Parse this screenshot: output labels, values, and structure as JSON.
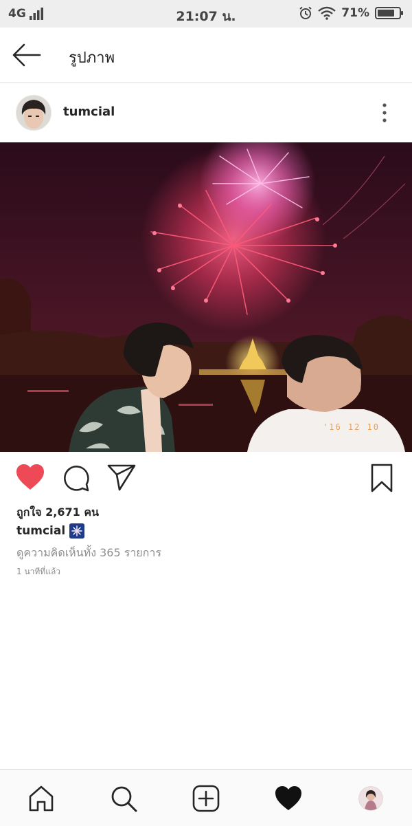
{
  "status_bar": {
    "network": "4G",
    "time": "21:07 น.",
    "battery": "71%"
  },
  "header": {
    "title": "รูปภาพ",
    "back_icon": "arrow-left-icon"
  },
  "post": {
    "username": "tumcial",
    "more_icon": "more-vertical-icon",
    "photo_stamp": "'16 12 10",
    "likes": "ถูกใจ 2,671 คน",
    "caption_user": "tumcial",
    "caption_emoji": "sparkler-emoji",
    "view_comments": "ดูความคิดเห็นทั้ง 365 รายการ",
    "time_ago": "1 นาทีที่แล้ว"
  },
  "actions": {
    "like_icon": "heart-filled-icon",
    "comment_icon": "comment-icon",
    "share_icon": "send-icon",
    "save_icon": "bookmark-icon",
    "like_color": "#ed4956"
  },
  "bottom_nav": {
    "items": [
      "home-icon",
      "search-icon",
      "add-post-icon",
      "activity-heart-icon",
      "profile-avatar"
    ]
  }
}
